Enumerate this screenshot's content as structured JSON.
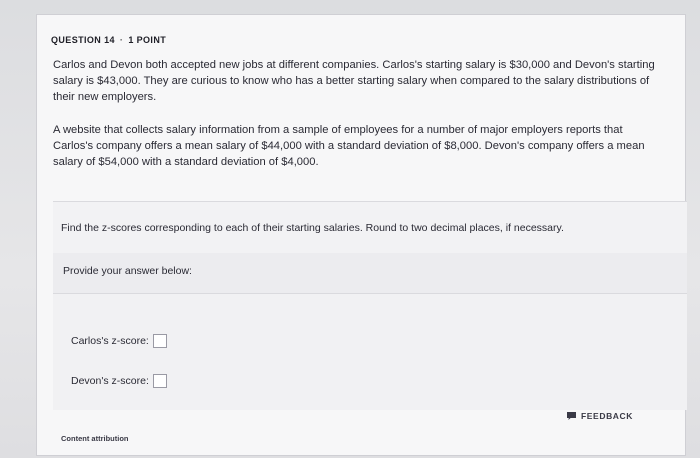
{
  "question": {
    "number_label": "QUESTION 14",
    "separator": "·",
    "points_label": "1 POINT"
  },
  "problem": {
    "paragraph1": "Carlos and Devon both accepted new jobs at different companies. Carlos's starting salary is $30,000 and Devon's starting salary is $43,000. They are curious to know who has a better starting salary when compared to the salary distributions of their new employers.",
    "paragraph2": "A website that collects salary information from a sample of employees for a number of major employers reports that Carlos's company offers a mean salary of $44,000 with a standard deviation of $8,000. Devon's company offers a mean salary of $54,000 with a standard deviation of $4,000.",
    "instruction": "Find the z-scores corresponding to each of their starting salaries. Round to two decimal places, if necessary."
  },
  "answer": {
    "prompt": "Provide your answer below:",
    "carlos_label": "Carlos's z-score:",
    "carlos_value": "",
    "devon_label": "Devon's z-score:",
    "devon_value": ""
  },
  "footer": {
    "feedback_label": "FEEDBACK",
    "feedback_icon": "flag-icon",
    "attribution_label": "Content attribution"
  }
}
